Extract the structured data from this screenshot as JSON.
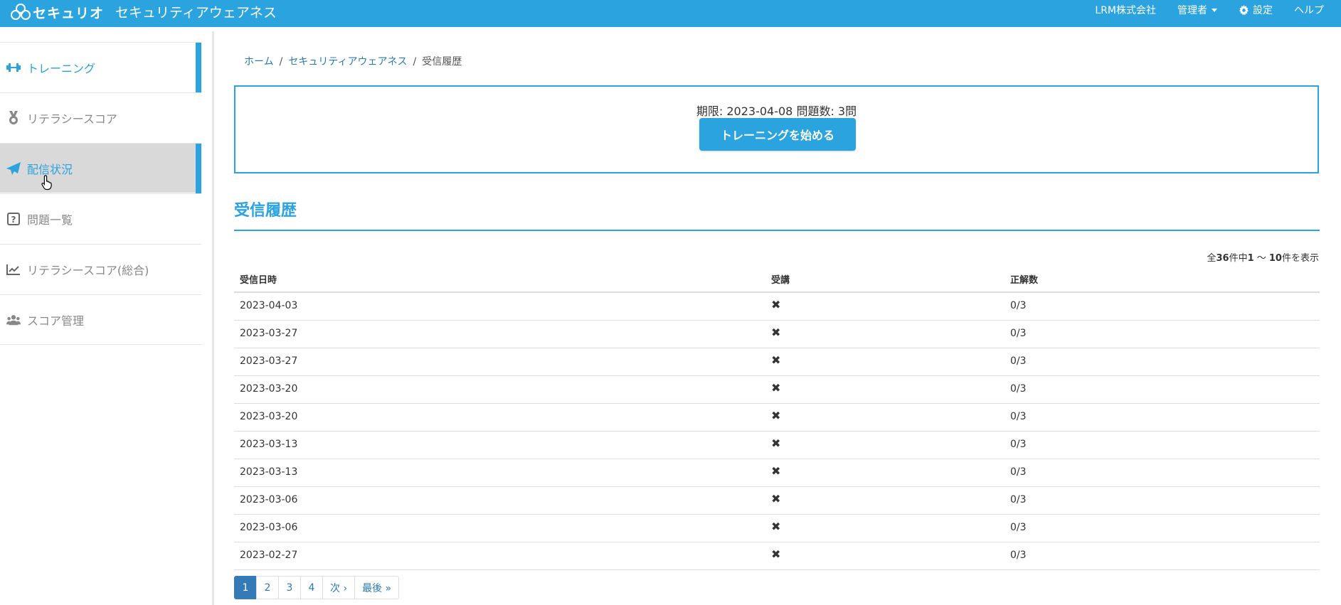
{
  "header": {
    "brand": "セキュリオ",
    "app_title": "セキュリティアウェアネス",
    "nav": {
      "company": "LRM株式会社",
      "admin": "管理者",
      "settings": "設定",
      "help": "ヘルプ"
    }
  },
  "sidebar": {
    "items": [
      {
        "label": "トレーニング",
        "icon": "dumbbell-icon"
      },
      {
        "label": "リテラシースコア",
        "icon": "medal-icon"
      },
      {
        "label": "配信状況",
        "icon": "paper-plane-icon"
      },
      {
        "label": "問題一覧",
        "icon": "question-square-icon"
      },
      {
        "label": "リテラシースコア(総合)",
        "icon": "line-chart-icon"
      },
      {
        "label": "スコア管理",
        "icon": "users-icon"
      }
    ]
  },
  "breadcrumb": {
    "home": "ホーム",
    "section": "セキュリティアウェアネス",
    "current": "受信履歴",
    "separator": "/"
  },
  "panel": {
    "deadline_text": "期限: 2023-04-08 問題数: 3問",
    "start_button": "トレーニングを始める"
  },
  "history": {
    "title": "受信履歴",
    "count": {
      "prefix": "全",
      "total": "36",
      "mid1": "件中",
      "from": "1",
      "tilde": " 〜 ",
      "to": "10",
      "suffix": "件を表示"
    },
    "columns": [
      "受信日時",
      "受講",
      "正解数"
    ],
    "rows": [
      {
        "date": "2023-04-03",
        "attended": "✖",
        "score": "0/3"
      },
      {
        "date": "2023-03-27",
        "attended": "✖",
        "score": "0/3"
      },
      {
        "date": "2023-03-27",
        "attended": "✖",
        "score": "0/3"
      },
      {
        "date": "2023-03-20",
        "attended": "✖",
        "score": "0/3"
      },
      {
        "date": "2023-03-20",
        "attended": "✖",
        "score": "0/3"
      },
      {
        "date": "2023-03-13",
        "attended": "✖",
        "score": "0/3"
      },
      {
        "date": "2023-03-13",
        "attended": "✖",
        "score": "0/3"
      },
      {
        "date": "2023-03-06",
        "attended": "✖",
        "score": "0/3"
      },
      {
        "date": "2023-03-06",
        "attended": "✖",
        "score": "0/3"
      },
      {
        "date": "2023-02-27",
        "attended": "✖",
        "score": "0/3"
      }
    ]
  },
  "pagination": {
    "pages": [
      "1",
      "2",
      "3",
      "4"
    ],
    "next": "次 ›",
    "last": "最後 »",
    "active": "1"
  },
  "colors": {
    "accent": "#2aa3df",
    "active_page": "#337ab7"
  }
}
